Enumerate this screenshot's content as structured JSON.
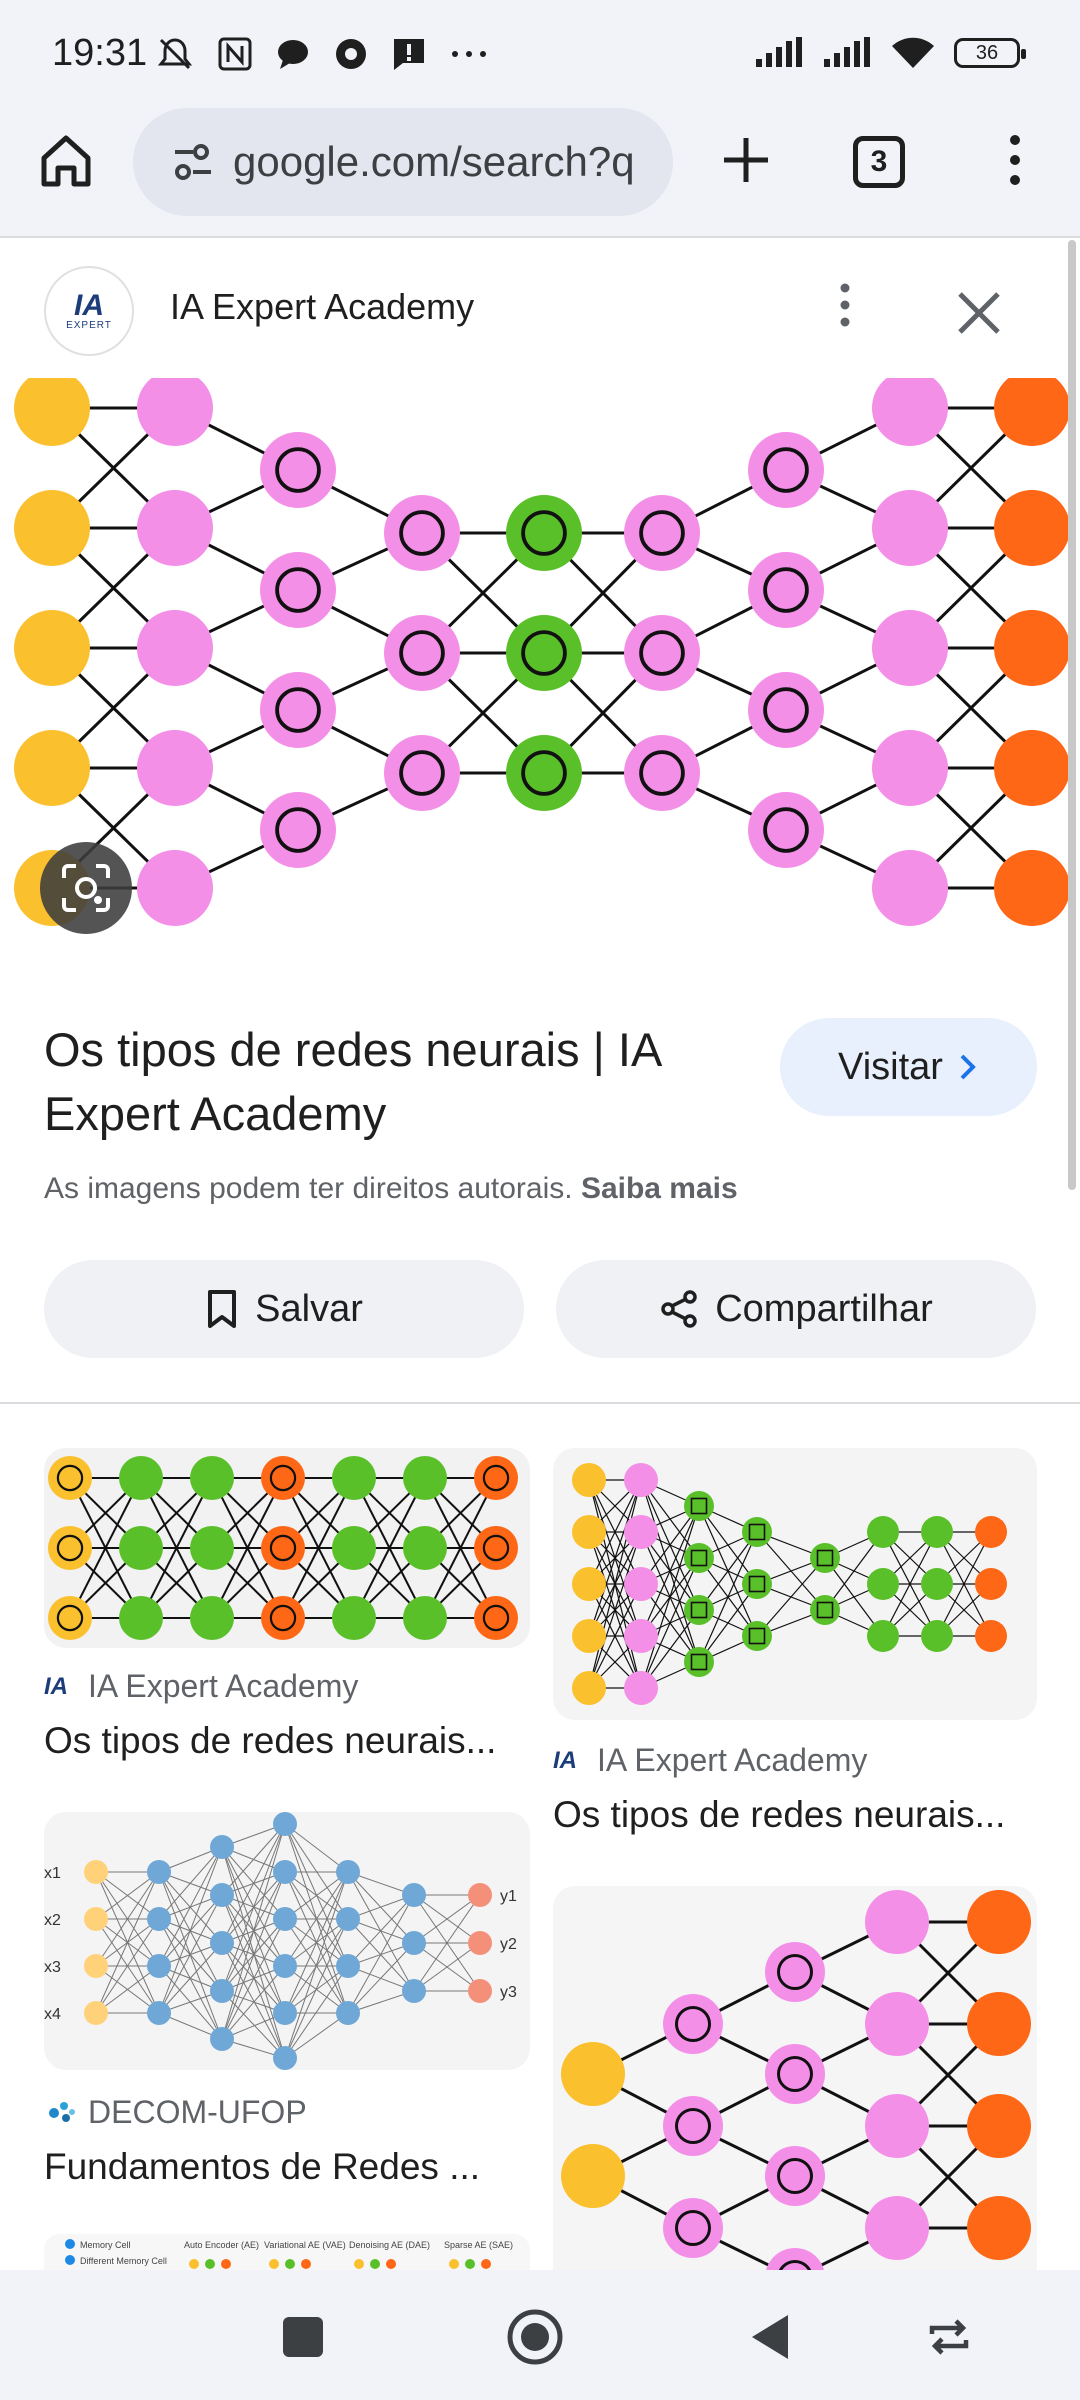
{
  "status_bar": {
    "time": "19:31",
    "battery": "36"
  },
  "browser": {
    "url": "google.com/search?q",
    "tab_count": "3"
  },
  "source": {
    "name": "IA Expert Academy",
    "logo_text": "IA",
    "logo_subtext": "EXPERT"
  },
  "result": {
    "title": "Os tipos de redes neurais | IA Expert Academy",
    "visit_label": "Visitar",
    "copyright_text": "As imagens podem ter direitos autorais.",
    "learn_more": "Saiba mais",
    "save_label": "Salvar",
    "share_label": "Compartilhar"
  },
  "related": [
    {
      "source": "IA Expert Academy",
      "title": "Os tipos de redes neurais..."
    },
    {
      "source": "IA Expert Academy",
      "title": "Os tipos de redes neurais..."
    },
    {
      "source": "DECOM-UFOP",
      "title": "Fundamentos de Redes ..."
    }
  ],
  "thumb_labels": {
    "inputs": [
      "x1",
      "x2",
      "x3",
      "x4"
    ],
    "outputs": [
      "y1",
      "y2",
      "y3"
    ],
    "legend_top": [
      "Memory Cell",
      "Different Memory Cell"
    ],
    "legend_cols": [
      "Auto Encoder (AE)",
      "Variational AE (VAE)",
      "Denoising AE (DAE)",
      "Sparse AE (SAE)"
    ]
  },
  "colors": {
    "input_node": "#fbc02d",
    "hidden_node": "#f48fe8",
    "core_node": "#5ac02a",
    "output_node": "#fd6715",
    "accent": "#1a73e8"
  }
}
